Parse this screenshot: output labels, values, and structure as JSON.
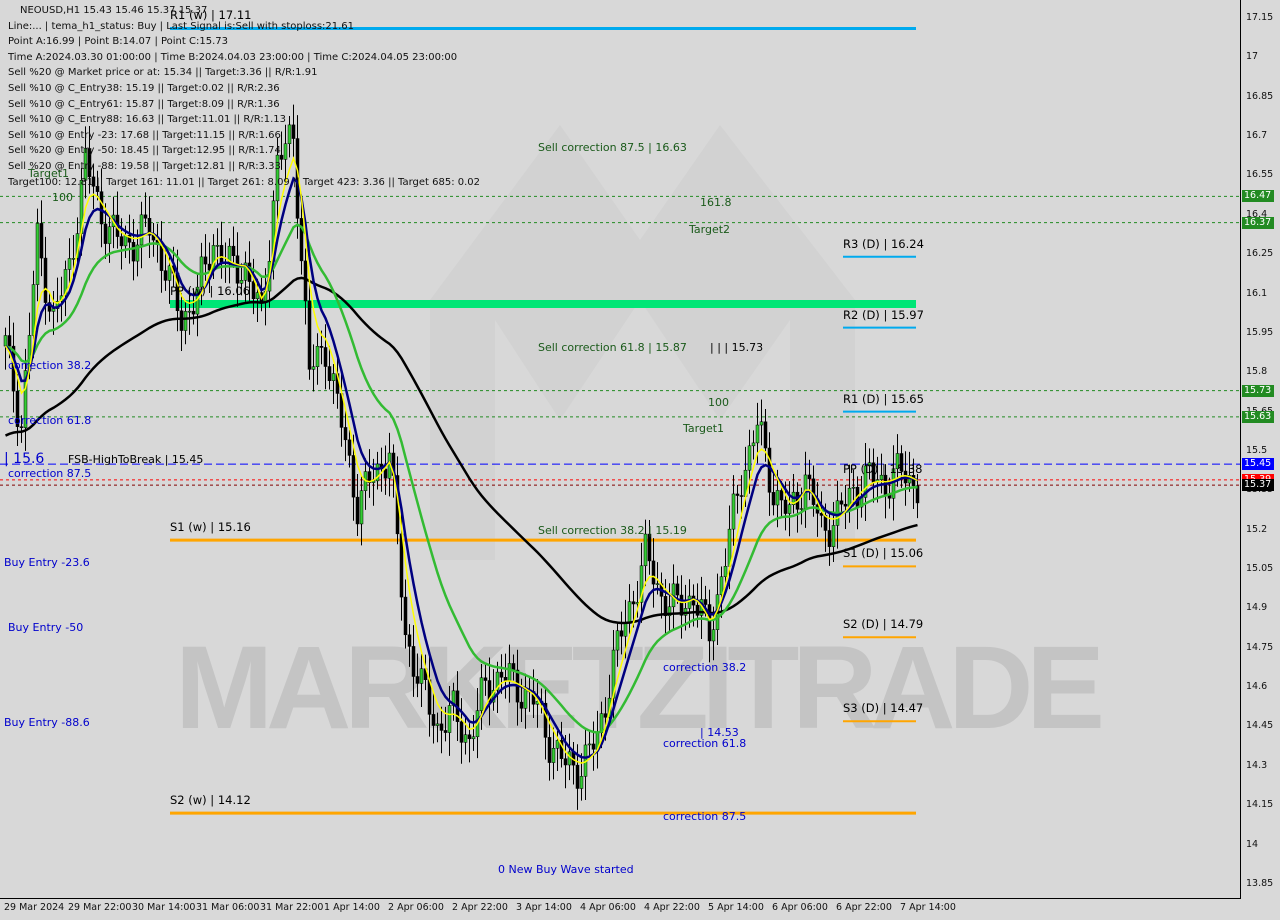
{
  "header": {
    "title": "NEOUSD,H1  15.43 15.46 15.37 15.37",
    "lines": [
      "Line:... | tema_h1_status: Buy | Last Signal is:Sell with stoploss:21.61",
      "Point A:16.99 | Point B:14.07 | Point C:15.73",
      "Time A:2024.03.30 01:00:00 | Time B:2024.04.03 23:00:00 | Time C:2024.04.05 23:00:00",
      "Sell %20 @ Market price or at: 15.34 || Target:3.36 || R/R:1.91",
      "Sell %10 @ C_Entry38: 15.19 || Target:0.02 || R/R:2.36",
      "Sell %10 @ C_Entry61: 15.87 || Target:8.09 || R/R:1.36",
      "Sell %10 @ C_Entry88: 16.63 || Target:11.01 || R/R:1.13",
      "Sell %10 @ Entry -23: 17.68 || Target:11.15 || R/R:1.66",
      "Sell %20 @ Entry -50: 18.45 || Target:12.95 || R/R:1.74",
      "Sell %20 @ Entry -88: 19.58 || Target:12.81 || R/R:3.33",
      "Target100: 12.81 || Target 161: 11.01 || Target 261: 8.09 || Target 423: 3.36 || Target 685: 0.02"
    ]
  },
  "watermark": "MARKETZITRADE",
  "chart_data": {
    "type": "candlestick",
    "symbol": "NEOUSD",
    "timeframe": "H1",
    "ylim": [
      13.85,
      17.15
    ],
    "y_ticks": [
      17.15,
      17.0,
      16.85,
      16.7,
      16.55,
      16.4,
      16.25,
      16.1,
      15.95,
      15.8,
      15.65,
      15.5,
      15.35,
      15.2,
      15.05,
      14.9,
      14.75,
      14.6,
      14.45,
      14.3,
      14.15,
      14.0,
      13.85
    ],
    "x_ticks": [
      "29 Mar 2024",
      "29 Mar 22:00",
      "30 Mar 14:00",
      "31 Mar 06:00",
      "31 Mar 22:00",
      "1 Apr 14:00",
      "2 Apr 06:00",
      "2 Apr 22:00",
      "3 Apr 14:00",
      "4 Apr 06:00",
      "4 Apr 22:00",
      "5 Apr 14:00",
      "6 Apr 06:00",
      "6 Apr 22:00",
      "7 Apr 14:00"
    ],
    "closes_every_4h": [
      15.9,
      15.6,
      16.3,
      16.0,
      16.2,
      16.6,
      16.4,
      16.3,
      16.3,
      16.35,
      16.2,
      16.0,
      16.1,
      16.3,
      16.2,
      16.2,
      16.0,
      16.6,
      16.7,
      15.8,
      15.9,
      15.6,
      15.3,
      15.4,
      15.5,
      14.8,
      14.6,
      14.45,
      14.5,
      14.4,
      14.6,
      14.65,
      14.6,
      14.55,
      14.4,
      14.3,
      14.3,
      14.4,
      14.7,
      14.9,
      15.1,
      14.95,
      14.9,
      14.95,
      14.8,
      15.1,
      15.4,
      15.6,
      15.35,
      15.25,
      15.4,
      15.2,
      15.25,
      15.35,
      15.4,
      15.38,
      15.42,
      15.37
    ],
    "price_tags": [
      {
        "value": "16.47",
        "color": "#228b22"
      },
      {
        "value": "16.37",
        "color": "#228b22"
      },
      {
        "value": "15.73",
        "color": "#228b22"
      },
      {
        "value": "15.63",
        "color": "#228b22"
      },
      {
        "value": "15.45",
        "color": "#0000ff"
      },
      {
        "value": "15.39",
        "color": "#ff0000"
      },
      {
        "value": "15.37",
        "color": "#000000"
      }
    ],
    "levels": [
      {
        "label": "R1 (w) | 17.11",
        "price": 17.11,
        "color": "#00aaee",
        "kind": "weekly"
      },
      {
        "label": "PP (w) | 16.06",
        "price": 16.06,
        "color": "#00e676",
        "kind": "weekly-thick"
      },
      {
        "label": "S1 (w) | 15.16",
        "price": 15.16,
        "color": "#ffa500",
        "kind": "weekly"
      },
      {
        "label": "S2 (w) | 14.12",
        "price": 14.12,
        "color": "#ffa500",
        "kind": "weekly"
      },
      {
        "label": "R3 (D) | 16.24",
        "price": 16.24,
        "color": "#00aaee",
        "kind": "daily"
      },
      {
        "label": "R2 (D) | 15.97",
        "price": 15.97,
        "color": "#00aaee",
        "kind": "daily"
      },
      {
        "label": "R1 (D) | 15.65",
        "price": 15.65,
        "color": "#00aaee",
        "kind": "daily"
      },
      {
        "label": "PP (D) | 15.38",
        "price": 15.38,
        "color": "#00aaee",
        "kind": "daily-label"
      },
      {
        "label": "S1 (D) | 15.06",
        "price": 15.06,
        "color": "#ffa500",
        "kind": "daily"
      },
      {
        "label": "S2 (D) | 14.79",
        "price": 14.79,
        "color": "#ffa500",
        "kind": "daily"
      },
      {
        "label": "S3 (D) | 14.47",
        "price": 14.47,
        "color": "#ffa500",
        "kind": "daily"
      }
    ],
    "annotations": [
      {
        "text": "Sell correction 87.5 | 16.63",
        "price": 16.65,
        "color": "#1a5a1a"
      },
      {
        "text": "161.8",
        "price": 16.44,
        "color": "#1a5a1a"
      },
      {
        "text": "Target2",
        "price": 16.34,
        "color": "#1a5a1a"
      },
      {
        "text": "Sell correction 61.8 | 15.87",
        "price": 15.89,
        "color": "#1a5a1a"
      },
      {
        "text": "| | | 15.73",
        "price": 15.89,
        "color": "#000"
      },
      {
        "text": "100",
        "price": 15.68,
        "color": "#1a5a1a"
      },
      {
        "text": "Target1",
        "price": 15.58,
        "color": "#1a5a1a"
      },
      {
        "text": "Sell correction 38.2 | 15.19",
        "price": 15.19,
        "color": "#1a5a1a"
      },
      {
        "text": "correction 38.2",
        "price": 14.67,
        "color": "#0000cc"
      },
      {
        "text": "| 14.53",
        "price": 14.42,
        "color": "#0000cc"
      },
      {
        "text": "correction 61.8",
        "price": 14.38,
        "color": "#0000cc"
      },
      {
        "text": "correction 87.5",
        "price": 14.1,
        "color": "#0000cc"
      },
      {
        "text": "0 New Buy Wave started",
        "price": 13.9,
        "color": "#0000cc"
      },
      {
        "text": "correction 38.2",
        "price": 15.82,
        "color": "#0000cc"
      },
      {
        "text": "correction 61.8",
        "price": 15.61,
        "color": "#0000cc"
      },
      {
        "text": "| 15.6",
        "price": 15.47,
        "color": "#0000cc"
      },
      {
        "text": "FSB-HighToBreak | 15.45",
        "price": 15.46,
        "color": "#000"
      },
      {
        "text": "correction 87.5",
        "price": 15.41,
        "color": "#0000cc"
      },
      {
        "text": "Buy Entry -23.6",
        "price": 15.07,
        "color": "#0000cc"
      },
      {
        "text": "Buy Entry -50",
        "price": 14.82,
        "color": "#0000cc"
      },
      {
        "text": "Buy Entry -88.6",
        "price": 14.46,
        "color": "#0000cc"
      },
      {
        "text": "Target1",
        "price": 16.55,
        "color": "#1a5a1a"
      },
      {
        "text": "100",
        "price": 16.46,
        "color": "#1a5a1a"
      }
    ],
    "dashed_levels": [
      {
        "price": 16.47,
        "color": "#228b22"
      },
      {
        "price": 16.37,
        "color": "#228b22"
      },
      {
        "price": 15.73,
        "color": "#228b22"
      },
      {
        "price": 15.63,
        "color": "#228b22"
      },
      {
        "price": 15.45,
        "color": "#0000ff"
      },
      {
        "price": 15.39,
        "color": "#ff0000"
      },
      {
        "price": 15.37,
        "color": "#800000"
      }
    ],
    "series_colors": {
      "up": "#33cc33",
      "down": "#000000",
      "ma_fast": "#ffff00",
      "ma_mid": "#000080",
      "ma_slow": "#33bb33",
      "ma_long": "#000000"
    }
  }
}
